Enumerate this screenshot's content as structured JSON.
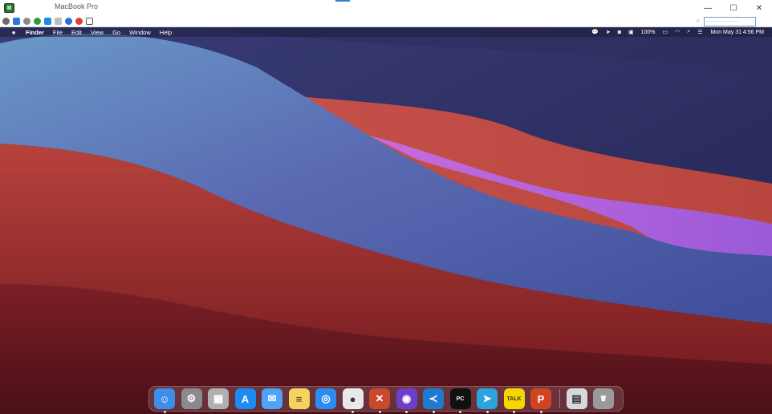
{
  "window": {
    "title": "MacBook Pro",
    "controls": {
      "minimize": "—",
      "maximize": "☐",
      "close": "✕"
    },
    "toolbar_field_value": "··············"
  },
  "mac": {
    "menubar": {
      "apple": "",
      "items": [
        "Finder",
        "File",
        "Edit",
        "View",
        "Go",
        "Window",
        "Help"
      ],
      "battery": "100%",
      "clock": "Mon May 31  4:56 PM"
    },
    "dock": {
      "apps": [
        {
          "name": "Finder",
          "color": "#3d8ee8",
          "glyph": "☺",
          "running": true
        },
        {
          "name": "System Preferences",
          "color": "#8a8a8a",
          "glyph": "⚙",
          "running": false
        },
        {
          "name": "Launchpad",
          "color": "#b0b0b0",
          "glyph": "▦",
          "running": false
        },
        {
          "name": "App Store",
          "color": "#1c8cf5",
          "glyph": "A",
          "running": false
        },
        {
          "name": "Mail",
          "color": "#4fa3f7",
          "glyph": "✉",
          "running": false
        },
        {
          "name": "Notes",
          "color": "#f5d35c",
          "glyph": "≡",
          "running": false
        },
        {
          "name": "Safari",
          "color": "#2d8cf0",
          "glyph": "◎",
          "running": false
        },
        {
          "name": "Chrome",
          "color": "#e9e9e9",
          "glyph": "●",
          "running": true
        },
        {
          "name": "Remote Desktop",
          "color": "#c64a2b",
          "glyph": "✕",
          "running": true
        },
        {
          "name": "GitHub Desktop",
          "color": "#6e40c9",
          "glyph": "◉",
          "running": true
        },
        {
          "name": "VS Code",
          "color": "#1f7ad1",
          "glyph": "≺",
          "running": true
        },
        {
          "name": "PyCharm",
          "color": "#111111",
          "glyph": "PC",
          "running": true
        },
        {
          "name": "Telegram",
          "color": "#2aa3df",
          "glyph": "➤",
          "running": true
        },
        {
          "name": "KakaoTalk",
          "color": "#f7d600",
          "glyph": "TALK",
          "running": true
        },
        {
          "name": "PowerPoint",
          "color": "#d04423",
          "glyph": "P",
          "running": true
        }
      ],
      "extras": [
        {
          "name": "Documents",
          "color": "#d9d9d9",
          "glyph": "▤"
        },
        {
          "name": "Trash",
          "color": "#9a9a9a",
          "glyph": "🗑"
        }
      ]
    }
  }
}
